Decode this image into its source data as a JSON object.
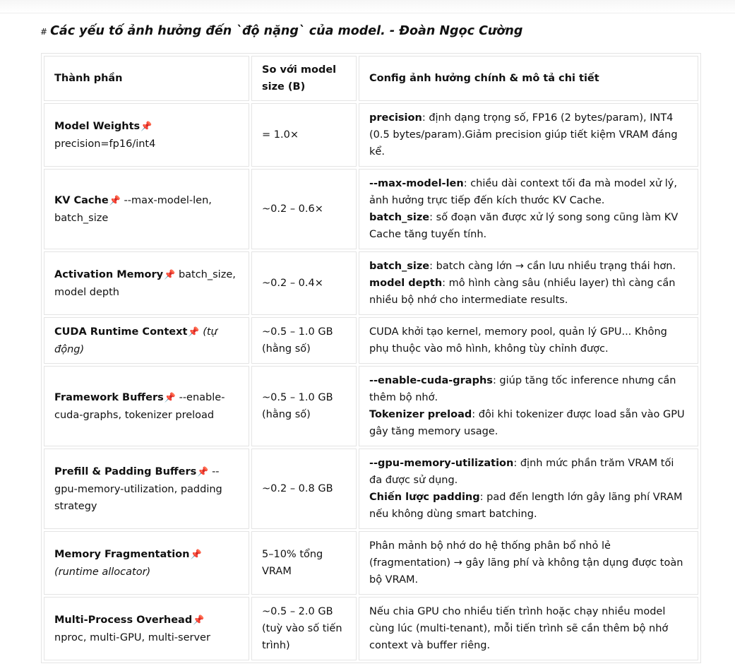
{
  "title": {
    "hash": "#",
    "text": "Các yếu tố ảnh hưởng đến `độ nặng` của model. - Đoàn Ngọc Cường"
  },
  "pin_icon": "📌",
  "headers": {
    "component": "Thành phần",
    "ratio": "So với model size (B)",
    "config": "Config ảnh hưởng chính & mô tả chi tiết"
  },
  "rows": [
    {
      "name": "Model Weights",
      "param": "precision=fp16/int4",
      "ratio": "= 1.0×",
      "desc": [
        {
          "term": "precision",
          "text": ": định dạng trọng số, FP16 (2 bytes/param), INT4 (0.5 bytes/param).Giảm precision giúp tiết kiệm VRAM đáng kể."
        }
      ]
    },
    {
      "name": "KV Cache",
      "param": "--max-model-len, batch_size",
      "ratio": "~0.2 – 0.6×",
      "desc": [
        {
          "term": "--max-model-len",
          "text": ": chiều dài context tối đa mà model xử lý, ảnh hưởng trực tiếp đến kích thước KV Cache."
        },
        {
          "term": "batch_size",
          "text": ": số đoạn văn được xử lý song song cũng làm KV Cache tăng tuyến tính."
        }
      ]
    },
    {
      "name": "Activation Memory",
      "param": "batch_size, model depth",
      "ratio": "~0.2 – 0.4×",
      "desc": [
        {
          "term": "batch_size",
          "text": ": batch càng lớn → cần lưu nhiều trạng thái hơn."
        },
        {
          "term": "model depth",
          "text": ": mô hình càng sâu (nhiều layer) thì càng cần nhiều bộ nhớ cho intermediate results."
        }
      ]
    },
    {
      "name": "CUDA Runtime Context",
      "param": "(tự động)",
      "ratio": "~0.5 – 1.0 GB (hằng số)",
      "desc": [
        {
          "term": "",
          "text": "CUDA khởi tạo kernel, memory pool, quản lý GPU... Không phụ thuộc vào mô hình, không tùy chỉnh được."
        }
      ]
    },
    {
      "name": "Framework Buffers",
      "param": "--enable-cuda-graphs, tokenizer preload",
      "ratio": "~0.5 – 1.0 GB (hằng số)",
      "desc": [
        {
          "term": "--enable-cuda-graphs",
          "text": ": giúp tăng tốc inference nhưng cần thêm bộ nhớ."
        },
        {
          "term": "Tokenizer preload",
          "text": ": đôi khi tokenizer được load sẵn vào GPU gây tăng memory usage."
        }
      ]
    },
    {
      "name": "Prefill & Padding Buffers",
      "param": "--gpu-memory-utilization, padding strategy",
      "ratio": "~0.2 – 0.8 GB",
      "desc": [
        {
          "term": "--gpu-memory-utilization",
          "text": ": định mức phần trăm VRAM tối đa được sử dụng."
        },
        {
          "term": "Chiến lược padding",
          "text": ": pad đến length lớn gây lãng phí VRAM nếu không dùng smart batching."
        }
      ]
    },
    {
      "name": "Memory Fragmentation",
      "param": "(runtime allocator)",
      "ratio": "5–10% tổng VRAM",
      "desc": [
        {
          "term": "",
          "text": "Phân mảnh bộ nhớ do hệ thống phân bổ nhỏ lẻ (fragmentation) → gây lãng phí và không tận dụng được toàn bộ VRAM."
        }
      ]
    },
    {
      "name": "Multi-Process Overhead",
      "param": "nproc, multi-GPU, multi-server",
      "ratio": "~0.5 – 2.0 GB (tuỳ vào số tiến trình)",
      "desc": [
        {
          "term": "",
          "text": "Nếu chia GPU cho nhiều tiến trình hoặc chạy nhiều model cùng lúc (multi-tenant), mỗi tiến trình sẽ cần thêm bộ nhớ context và buffer riêng."
        }
      ]
    }
  ]
}
